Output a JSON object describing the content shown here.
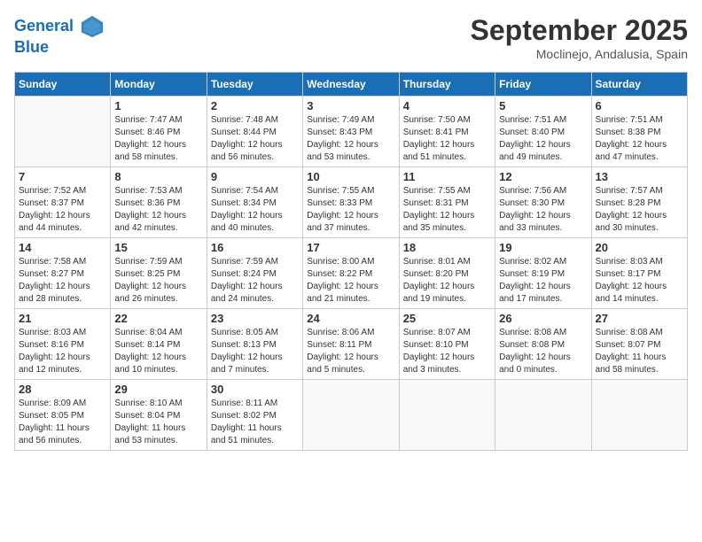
{
  "header": {
    "logo_line1": "General",
    "logo_line2": "Blue",
    "month": "September 2025",
    "location": "Moclinejo, Andalusia, Spain"
  },
  "weekdays": [
    "Sunday",
    "Monday",
    "Tuesday",
    "Wednesday",
    "Thursday",
    "Friday",
    "Saturday"
  ],
  "weeks": [
    [
      {
        "day": "",
        "info": ""
      },
      {
        "day": "1",
        "info": "Sunrise: 7:47 AM\nSunset: 8:46 PM\nDaylight: 12 hours\nand 58 minutes."
      },
      {
        "day": "2",
        "info": "Sunrise: 7:48 AM\nSunset: 8:44 PM\nDaylight: 12 hours\nand 56 minutes."
      },
      {
        "day": "3",
        "info": "Sunrise: 7:49 AM\nSunset: 8:43 PM\nDaylight: 12 hours\nand 53 minutes."
      },
      {
        "day": "4",
        "info": "Sunrise: 7:50 AM\nSunset: 8:41 PM\nDaylight: 12 hours\nand 51 minutes."
      },
      {
        "day": "5",
        "info": "Sunrise: 7:51 AM\nSunset: 8:40 PM\nDaylight: 12 hours\nand 49 minutes."
      },
      {
        "day": "6",
        "info": "Sunrise: 7:51 AM\nSunset: 8:38 PM\nDaylight: 12 hours\nand 47 minutes."
      }
    ],
    [
      {
        "day": "7",
        "info": "Sunrise: 7:52 AM\nSunset: 8:37 PM\nDaylight: 12 hours\nand 44 minutes."
      },
      {
        "day": "8",
        "info": "Sunrise: 7:53 AM\nSunset: 8:36 PM\nDaylight: 12 hours\nand 42 minutes."
      },
      {
        "day": "9",
        "info": "Sunrise: 7:54 AM\nSunset: 8:34 PM\nDaylight: 12 hours\nand 40 minutes."
      },
      {
        "day": "10",
        "info": "Sunrise: 7:55 AM\nSunset: 8:33 PM\nDaylight: 12 hours\nand 37 minutes."
      },
      {
        "day": "11",
        "info": "Sunrise: 7:55 AM\nSunset: 8:31 PM\nDaylight: 12 hours\nand 35 minutes."
      },
      {
        "day": "12",
        "info": "Sunrise: 7:56 AM\nSunset: 8:30 PM\nDaylight: 12 hours\nand 33 minutes."
      },
      {
        "day": "13",
        "info": "Sunrise: 7:57 AM\nSunset: 8:28 PM\nDaylight: 12 hours\nand 30 minutes."
      }
    ],
    [
      {
        "day": "14",
        "info": "Sunrise: 7:58 AM\nSunset: 8:27 PM\nDaylight: 12 hours\nand 28 minutes."
      },
      {
        "day": "15",
        "info": "Sunrise: 7:59 AM\nSunset: 8:25 PM\nDaylight: 12 hours\nand 26 minutes."
      },
      {
        "day": "16",
        "info": "Sunrise: 7:59 AM\nSunset: 8:24 PM\nDaylight: 12 hours\nand 24 minutes."
      },
      {
        "day": "17",
        "info": "Sunrise: 8:00 AM\nSunset: 8:22 PM\nDaylight: 12 hours\nand 21 minutes."
      },
      {
        "day": "18",
        "info": "Sunrise: 8:01 AM\nSunset: 8:20 PM\nDaylight: 12 hours\nand 19 minutes."
      },
      {
        "day": "19",
        "info": "Sunrise: 8:02 AM\nSunset: 8:19 PM\nDaylight: 12 hours\nand 17 minutes."
      },
      {
        "day": "20",
        "info": "Sunrise: 8:03 AM\nSunset: 8:17 PM\nDaylight: 12 hours\nand 14 minutes."
      }
    ],
    [
      {
        "day": "21",
        "info": "Sunrise: 8:03 AM\nSunset: 8:16 PM\nDaylight: 12 hours\nand 12 minutes."
      },
      {
        "day": "22",
        "info": "Sunrise: 8:04 AM\nSunset: 8:14 PM\nDaylight: 12 hours\nand 10 minutes."
      },
      {
        "day": "23",
        "info": "Sunrise: 8:05 AM\nSunset: 8:13 PM\nDaylight: 12 hours\nand 7 minutes."
      },
      {
        "day": "24",
        "info": "Sunrise: 8:06 AM\nSunset: 8:11 PM\nDaylight: 12 hours\nand 5 minutes."
      },
      {
        "day": "25",
        "info": "Sunrise: 8:07 AM\nSunset: 8:10 PM\nDaylight: 12 hours\nand 3 minutes."
      },
      {
        "day": "26",
        "info": "Sunrise: 8:08 AM\nSunset: 8:08 PM\nDaylight: 12 hours\nand 0 minutes."
      },
      {
        "day": "27",
        "info": "Sunrise: 8:08 AM\nSunset: 8:07 PM\nDaylight: 11 hours\nand 58 minutes."
      }
    ],
    [
      {
        "day": "28",
        "info": "Sunrise: 8:09 AM\nSunset: 8:05 PM\nDaylight: 11 hours\nand 56 minutes."
      },
      {
        "day": "29",
        "info": "Sunrise: 8:10 AM\nSunset: 8:04 PM\nDaylight: 11 hours\nand 53 minutes."
      },
      {
        "day": "30",
        "info": "Sunrise: 8:11 AM\nSunset: 8:02 PM\nDaylight: 11 hours\nand 51 minutes."
      },
      {
        "day": "",
        "info": ""
      },
      {
        "day": "",
        "info": ""
      },
      {
        "day": "",
        "info": ""
      },
      {
        "day": "",
        "info": ""
      }
    ]
  ]
}
